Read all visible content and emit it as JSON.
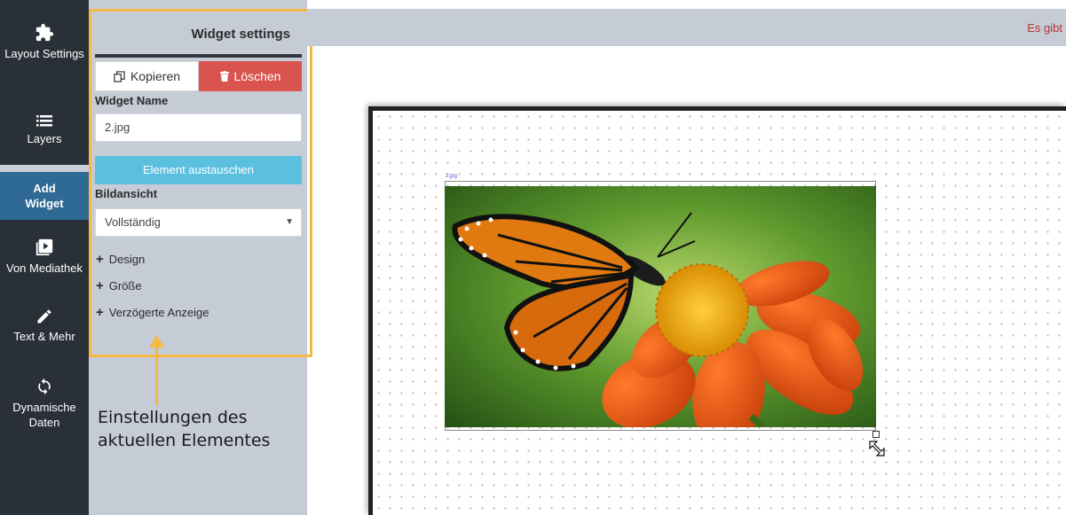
{
  "sidebar": {
    "items": [
      {
        "label": "Layout Settings",
        "icon": "puzzle-icon"
      },
      {
        "label": "Layers",
        "icon": "list-icon"
      },
      {
        "label": "Add Widget",
        "icon": "add-widget-icon"
      },
      {
        "label": "Von Mediathek",
        "icon": "media-play-icon"
      },
      {
        "label": "Text & Mehr",
        "icon": "pencil-icon"
      },
      {
        "label": "Dynamische Daten",
        "icon": "sync-icon"
      }
    ]
  },
  "panel": {
    "title": "Widget settings",
    "copy_label": "Kopieren",
    "delete_label": "Löschen",
    "widget_name_label": "Widget Name",
    "widget_name_value": "2.jpg",
    "swap_label": "Element austauschen",
    "view_label": "Bildansicht",
    "view_value": "Vollständig",
    "accordion": [
      "Design",
      "Größe",
      "Verzögerte Anzeige"
    ]
  },
  "annotation": {
    "line1": "Einstellungen des",
    "line2": "aktuellen Elementes"
  },
  "topbar": {
    "note": "Es gibt"
  },
  "canvas": {
    "widget_caption": "2.jpg",
    "image": "butterfly-on-orange-flower-photo"
  },
  "colors": {
    "sidebar_bg": "#2a3038",
    "active_item": "#2e6a93",
    "panel_bg": "#c5ccd6",
    "delete_red": "#d9534f",
    "swap_blue": "#5bc0de",
    "highlight_orange": "#f5b942"
  }
}
